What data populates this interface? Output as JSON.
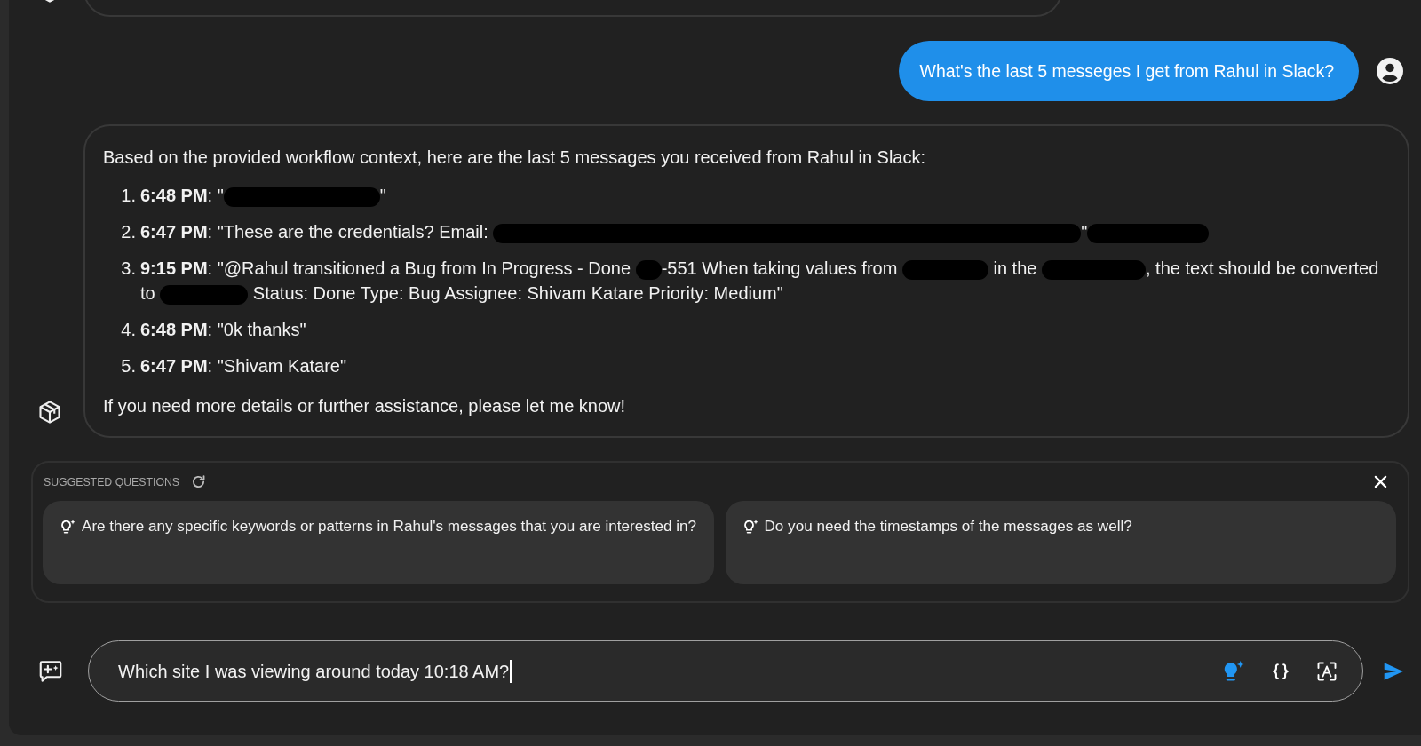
{
  "messages": [
    {
      "kind": "assistant"
    },
    {
      "kind": "user",
      "text": "What's the last 5 messeges I get from Rahul in Slack?"
    },
    {
      "kind": "assistant",
      "intro": "Based on the provided workflow context, here are the last 5 messages you received from Rahul in Slack:",
      "items": [
        {
          "number": "1.",
          "time": "6:48 PM",
          "parts": [
            {
              "kind": "text",
              "text": ": \""
            },
            {
              "kind": "redacted"
            },
            {
              "kind": "text",
              "text": "\""
            }
          ]
        },
        {
          "number": "2.",
          "time": "6:47 PM",
          "parts": [
            {
              "kind": "text",
              "text": ": \"These are the credentials? Email: "
            },
            {
              "kind": "redacted"
            },
            {
              "kind": "text",
              "text": "\""
            },
            {
              "kind": "redacted"
            }
          ]
        },
        {
          "number": "3.",
          "time": "9:15 PM",
          "parts": [
            {
              "kind": "text",
              "text": ": \"@Rahul transitioned a Bug from In Progress - Done "
            },
            {
              "kind": "redacted"
            },
            {
              "kind": "text",
              "text": "-551 When taking values from "
            },
            {
              "kind": "redacted"
            },
            {
              "kind": "text",
              "text": " in the "
            },
            {
              "kind": "redacted"
            },
            {
              "kind": "text",
              "text": ", the text should be converted to "
            },
            {
              "kind": "redacted"
            },
            {
              "kind": "text",
              "text": " Status: Done Type: Bug Assignee: Shivam Katare Priority: Medium\""
            }
          ]
        },
        {
          "number": "4.",
          "time": "6:48 PM",
          "parts": [
            {
              "kind": "text",
              "text": ": \"0k thanks\""
            }
          ]
        },
        {
          "number": "5.",
          "time": "6:47 PM",
          "parts": [
            {
              "kind": "text",
              "text": ": \"Shivam Katare\""
            }
          ]
        }
      ],
      "closing": "If you need more details or further assistance, please let me know!"
    }
  ],
  "suggested_questions": {
    "title": "SUGGESTED QUESTIONS",
    "questions": [
      "Are there any specific keywords or patterns in Rahul's messages that you are interested in?",
      "Do you need the timestamps of the messages as well?"
    ]
  },
  "input": {
    "value": "Which site I was viewing around today 10:18 AM?"
  }
}
